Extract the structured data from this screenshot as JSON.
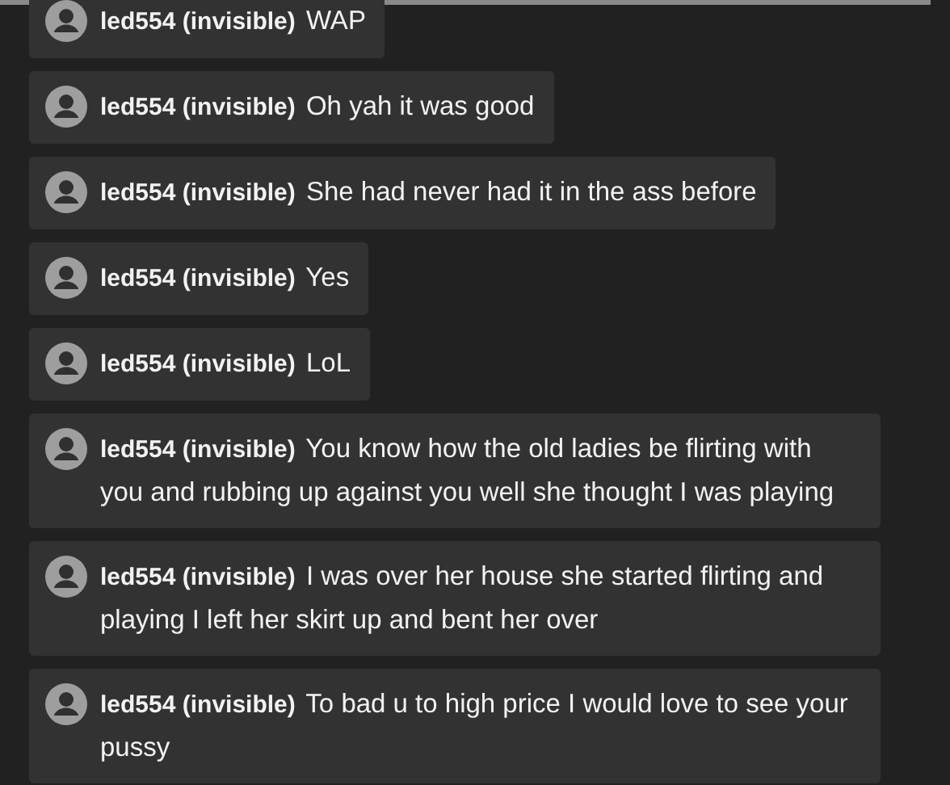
{
  "messages": [
    {
      "user": "led554 (invisible)",
      "text": "WAP"
    },
    {
      "user": "led554 (invisible)",
      "text": "Oh yah it was good"
    },
    {
      "user": "led554 (invisible)",
      "text": "She had never had it in the ass before"
    },
    {
      "user": "led554 (invisible)",
      "text": "Yes"
    },
    {
      "user": "led554 (invisible)",
      "text": "LoL"
    },
    {
      "user": "led554 (invisible)",
      "text": "You know how the old ladies be flirting with you and rubbing up against you well she thought I was playing"
    },
    {
      "user": "led554 (invisible)",
      "text": "I was over her house she started flirting and playing I left her skirt up and bent her over"
    },
    {
      "user": "led554 (invisible)",
      "text": "To bad u to high price I would love to see your pussy"
    }
  ]
}
